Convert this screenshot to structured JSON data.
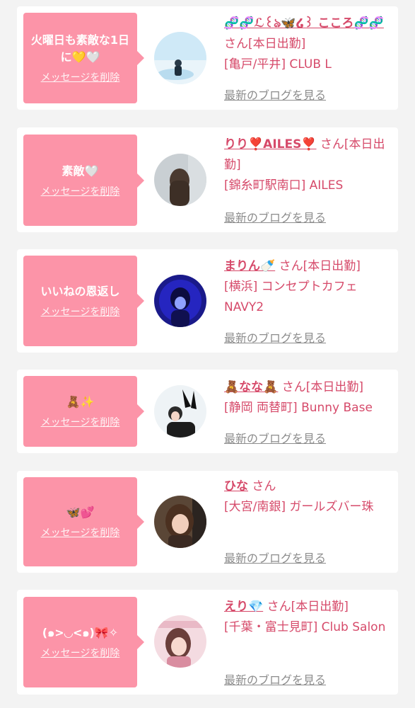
{
  "delete_label": "メッセージを削除",
  "blog_label": "最新のブログを見る",
  "cards": [
    {
      "message": "火曜日も素敵な1日に💛🤍",
      "name": "🧬🧬ℒ꒰ঌ🦋໒꒱ こころ🧬🧬",
      "suffix": "さん[本日出勤]",
      "shop": "[亀戸/平井] CLUB L"
    },
    {
      "message": "素敵🤍",
      "name": "りり❣️AILES❣️",
      "suffix": "さん[本日出勤]",
      "shop": "[錦糸町駅南口] AILES"
    },
    {
      "message": "いいねの恩返し",
      "name": "まりん🍼",
      "suffix": "さん[本日出勤]",
      "shop": "[横浜] コンセプトカフェNAVY2"
    },
    {
      "message": "🧸✨",
      "name": "🧸なな🧸",
      "suffix": "さん[本日出勤]",
      "shop": "[静岡 両替町] Bunny Base"
    },
    {
      "message": "🦋💕",
      "name": "ひな",
      "suffix": "さん",
      "shop": "[大宮/南銀] ガールズバー珠"
    },
    {
      "message": "(๑>◡<๑)🎀✧",
      "name": "えり💎",
      "suffix": "さん[本日出勤]",
      "shop": "[千葉・富士見町] Club Salon"
    }
  ]
}
